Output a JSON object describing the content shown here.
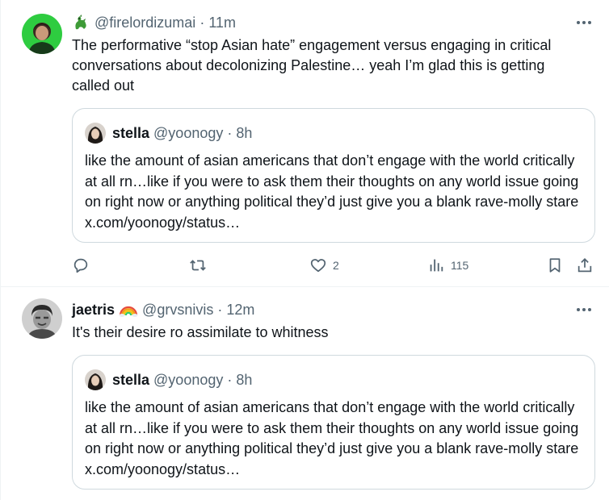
{
  "tweets": [
    {
      "badge_icon": "dragon-emoji",
      "handle": "@firelordizumai",
      "separator": "·",
      "time": "11m",
      "text": "The performative “stop Asian hate” engagement versus engaging in critical conversations about decolonizing Palestine… yeah I’m glad this is getting called out",
      "quote": {
        "name": "stella",
        "handle": "@yoonogy",
        "separator": "·",
        "time": "8h",
        "text": "like the amount of asian americans that don’t engage with the world critically at all rn…like if you were to ask them their thoughts on any world issue going on right now or anything political they’d just give you a blank rave-molly stare x.com/yoonogy/status…"
      },
      "actions": {
        "replies": "",
        "reposts": "",
        "likes": "2",
        "views": "115"
      }
    },
    {
      "name": "jaetris",
      "badge_icon": "rainbow-emoji",
      "handle": "@grvsnivis",
      "separator": "·",
      "time": "12m",
      "text": "It's their desire ro assimilate to whitness",
      "quote": {
        "name": "stella",
        "handle": "@yoonogy",
        "separator": "·",
        "time": "8h",
        "text": "like the amount of asian americans that don’t engage with the world critically at all rn…like if you were to ask them their thoughts on any world issue going on right now or anything political they’d just give you a blank rave-molly stare x.com/yoonogy/status…"
      }
    }
  ],
  "colors": {
    "text": "#0f1419",
    "muted": "#536471",
    "border": "#cfd9de",
    "divider": "#eff3f4"
  }
}
